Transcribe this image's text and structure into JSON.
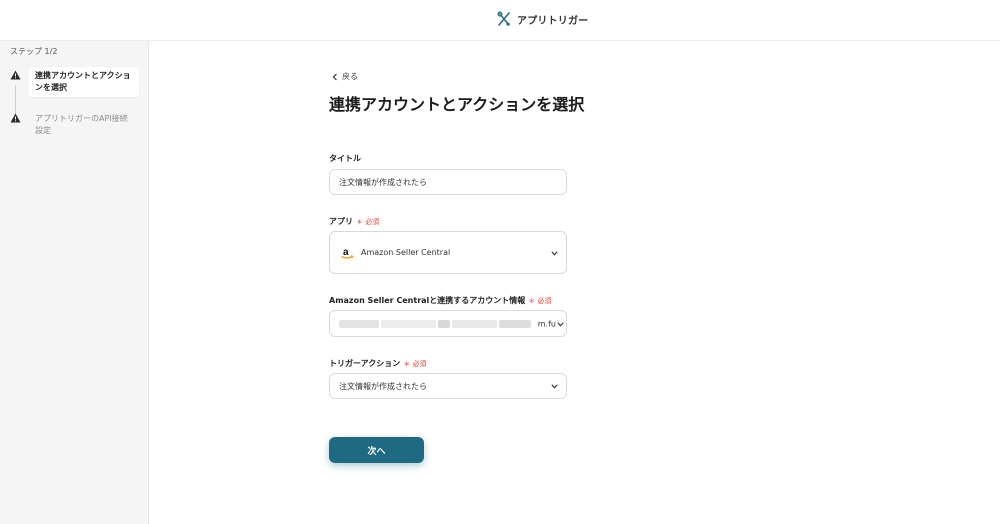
{
  "header": {
    "app_name": "アプリトリガー",
    "logo_icon": "wrench-cross-icon",
    "accent": "#1e6a82"
  },
  "sidebar": {
    "step_counter": "ステップ 1/2",
    "steps": [
      {
        "label": "連携アカウントとアクションを選択",
        "active": true,
        "icon": "warning-icon"
      },
      {
        "label": "アプリトリガーのAPI接続設定",
        "active": false,
        "icon": "warning-icon"
      }
    ]
  },
  "main": {
    "back_label": "戻る",
    "title": "連携アカウントとアクションを選択",
    "fields": {
      "title_field": {
        "label": "タイトル",
        "value": "注文情報が作成されたら"
      },
      "app": {
        "label": "アプリ",
        "required": "必須",
        "value": "Amazon Seller Central",
        "icon": "amazon-icon"
      },
      "account": {
        "label": "Amazon Seller Centralと連携するアカウント情報",
        "required": "必須",
        "value_tail": "m.fu"
      },
      "trigger_action": {
        "label": "トリガーアクション",
        "required": "必須",
        "value": "注文情報が作成されたら"
      }
    },
    "next_label": "次へ"
  }
}
